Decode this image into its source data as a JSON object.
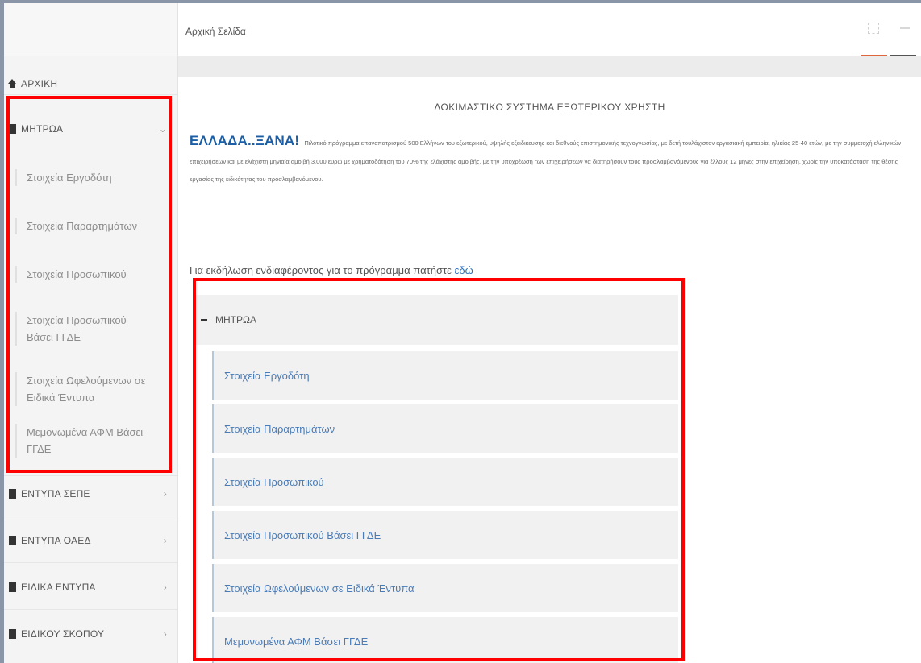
{
  "header": {
    "title": "Αρχική Σελίδα"
  },
  "sidebar": {
    "home_label": "ΑΡΧΙΚΗ",
    "registry": {
      "label": "ΜΗΤΡΩΑ",
      "items": [
        "Στοιχεία Εργοδότη",
        "Στοιχεία Παραρτημάτων",
        "Στοιχεία Προσωπικού",
        "Στοιχεία Προσωπικού Βάσει ΓΓΔΕ",
        "Στοιχεία Ωφελούμενων σε Ειδικά Έντυπα",
        "Μεμονωμένα ΑΦΜ Βάσει ΓΓΔΕ"
      ]
    },
    "sections": [
      "ΕΝΤΥΠΑ ΣΕΠΕ",
      "ΕΝΤΥΠΑ ΟΑΕΔ",
      "ΕΙΔΙΚΑ ΕΝΤΥΠΑ",
      "ΕΙΔΙΚΟΥ ΣΚΟΠΟΥ"
    ]
  },
  "main": {
    "system_heading": "ΔΟΚΙΜΑΣΤΙΚΟ ΣΥΣΤΗΜΑ ΕΞΩΤΕΡΙΚΟΥ ΧΡΗΣΤΗ",
    "brand": "ΕΛΛΑΔΑ..ΞΑΝΑ!",
    "promo_text": "Πιλοτικό πρόγραμμα επαναπατρισμού 500 Ελλήνων του εξωτερικού, υψηλής εξειδικευσης και διεθνούς επιστημονικής τεχνογνωσίας, με δετή τουλάχιστον εργασιακή εμπειρία, ηλικίας 25-40 ετών, με την συμμετοχή ελληνικών επιχειρήσεων και με ελάχιστη μηνιαία αμοιβή 3.000 ευρώ με χρηματοδότηση του 70% της ελάχιστης αμοιβής, με την υποχρέωση των επιχειρήσεων να διατηρήσουν τους προσλαμβανόμενους για έλλους 12 μήνες στην επιχείρηση, χωρίς την υποκατάσταση της θέσης εργασίας της ειδικότητας του προσλαμβανόμενου.",
    "interest_text": "Για εκδήλωση ενδιαφέροντος για το πρόγραμμα πατήστε",
    "interest_link": "εδώ",
    "panel": {
      "title": "ΜΗΤΡΩΑ",
      "links": [
        "Στοιχεία Εργοδότη",
        "Στοιχεία Παραρτημάτων",
        "Στοιχεία Προσωπικού",
        "Στοιχεία Προσωπικού Βάσει ΓΓΔΕ",
        "Στοιχεία Ωφελούμενων σε Ειδικά Έντυπα",
        "Μεμονωμένα ΑΦΜ Βάσει ΓΓΔΕ"
      ]
    }
  },
  "colors": {
    "accent_blue": "#1b5ea6",
    "link_blue": "#4a7cb7",
    "highlight_red": "#ff0000",
    "tab_orange": "#e0643c"
  }
}
